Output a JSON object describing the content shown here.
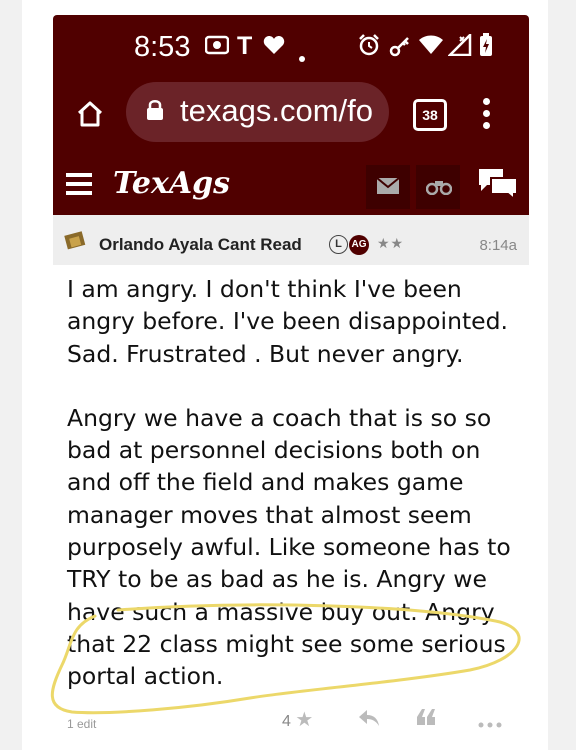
{
  "status_bar": {
    "time": "8:53",
    "battery_icon": "battery-charging-icon"
  },
  "browser": {
    "url": "texags.com/fo",
    "tab_count": "38"
  },
  "site": {
    "logo": "TexAgs",
    "brand_color": "#500000"
  },
  "post": {
    "author": "Orlando Ayala Cant Read",
    "badge_l": "L",
    "badge_ag": "AG",
    "stars": "★★",
    "time": "8:14a",
    "paragraphs": [
      "I am angry. I don't think I've been angry before. I've been disappointed. Sad. Frustrated . But never angry.",
      "Angry we have a coach that is so so bad at personnel decisions both on and off the field and makes game manager moves that almost seem purposely awful. Like someone has to TRY to be as bad as he is. Angry we have such a massive buy out. Angry that 22 class might see some serious portal action."
    ],
    "edited": "1 edit",
    "likes": "4"
  }
}
